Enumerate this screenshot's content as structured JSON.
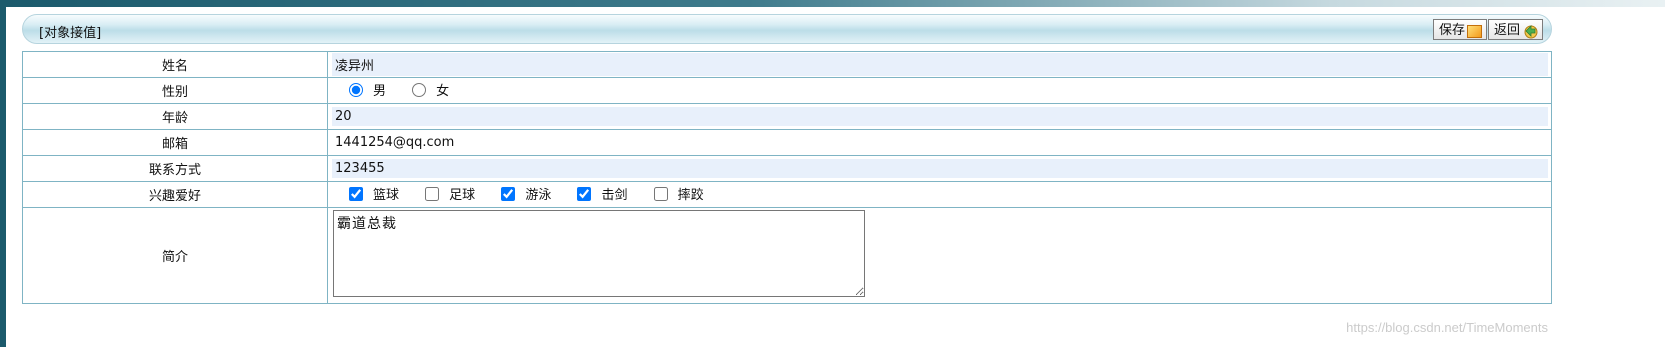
{
  "panel": {
    "title": "[对象接值]",
    "save_label": "保存",
    "back_label": "返回"
  },
  "form": {
    "name": {
      "label": "姓名",
      "value": "凌异州"
    },
    "gender": {
      "label": "性别",
      "options": [
        {
          "label": "男",
          "checked": true
        },
        {
          "label": "女",
          "checked": false
        }
      ]
    },
    "age": {
      "label": "年龄",
      "value": "20"
    },
    "email": {
      "label": "邮箱",
      "value": "1441254@qq.com"
    },
    "contact": {
      "label": "联系方式",
      "value": "123455"
    },
    "hobbies": {
      "label": "兴趣爱好",
      "options": [
        {
          "label": "篮球",
          "checked": true
        },
        {
          "label": "足球",
          "checked": false
        },
        {
          "label": "游泳",
          "checked": true
        },
        {
          "label": "击剑",
          "checked": true
        },
        {
          "label": "摔跤",
          "checked": false
        }
      ]
    },
    "intro": {
      "label": "简介",
      "value": "霸道总裁"
    }
  },
  "watermark": "https://blog.csdn.net/TimeMoments",
  "colors": {
    "accent": "#0075ff",
    "border": "#7fb4c4",
    "value_bg": "#e8f0fb",
    "left_strip": "#1b5a6c"
  }
}
